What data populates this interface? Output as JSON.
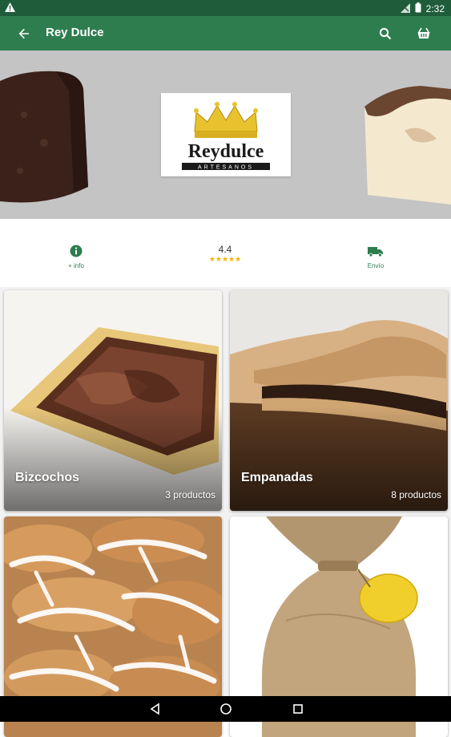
{
  "status_bar": {
    "time": "2:32"
  },
  "app_bar": {
    "title": "Rey Dulce"
  },
  "hero": {
    "logo_text": "Reydulce",
    "logo_subtext": "ARTESANOS"
  },
  "info_row": {
    "info_label": "+ info",
    "rating_value": "4.4",
    "stars": "★★★★★",
    "shipping_label": "Envío"
  },
  "categories": [
    {
      "name": "Bizcochos",
      "count": "3 productos"
    },
    {
      "name": "Empanadas",
      "count": "8 productos"
    },
    {
      "name": "",
      "count": ""
    },
    {
      "name": "",
      "count": ""
    }
  ],
  "colors": {
    "primary": "#2e7d4f",
    "status": "#1f5d3a",
    "star": "#f3b400"
  }
}
